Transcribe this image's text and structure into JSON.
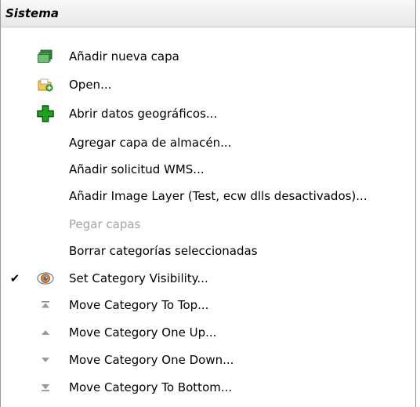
{
  "menu": {
    "header": "Sistema",
    "items": [
      {
        "label": "Añadir nueva capa",
        "icon": "layer-icon",
        "enabled": true,
        "checked": false
      },
      {
        "label": "Open...",
        "icon": "open-folder-icon",
        "enabled": true,
        "checked": false
      },
      {
        "label": "Abrir datos geográficos...",
        "icon": "green-plus-icon",
        "enabled": true,
        "checked": false
      },
      {
        "label": "Agregar capa de almacén...",
        "icon": "",
        "enabled": true,
        "checked": false
      },
      {
        "label": "Añadir solicitud WMS...",
        "icon": "",
        "enabled": true,
        "checked": false
      },
      {
        "label": "Añadir Image Layer (Test, ecw dlls desactivados)...",
        "icon": "",
        "enabled": true,
        "checked": false
      },
      {
        "label": "Pegar capas",
        "icon": "",
        "enabled": false,
        "checked": false
      },
      {
        "label": "Borrar categorías seleccionadas",
        "icon": "",
        "enabled": true,
        "checked": false
      },
      {
        "label": "Set Category Visibility...",
        "icon": "eye-icon",
        "enabled": true,
        "checked": true
      },
      {
        "label": "Move Category To Top...",
        "icon": "move-to-top-icon",
        "enabled": true,
        "checked": false
      },
      {
        "label": "Move Category One Up...",
        "icon": "move-up-icon",
        "enabled": true,
        "checked": false
      },
      {
        "label": "Move Category One Down...",
        "icon": "move-down-icon",
        "enabled": true,
        "checked": false
      },
      {
        "label": "Move Category To Bottom...",
        "icon": "move-to-bottom-icon",
        "enabled": true,
        "checked": false
      }
    ],
    "check_glyph": "✔"
  }
}
